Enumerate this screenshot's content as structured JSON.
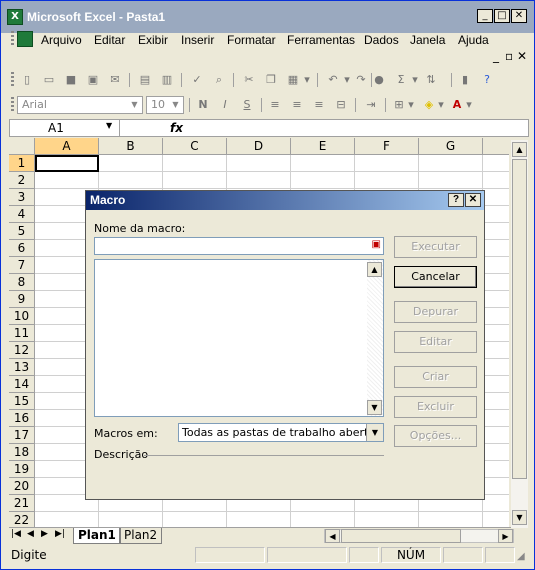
{
  "window": {
    "title": "Microsoft Excel - Pasta1"
  },
  "menu": [
    "Arquivo",
    "Editar",
    "Exibir",
    "Inserir",
    "Formatar",
    "Ferramentas",
    "Dados",
    "Janela",
    "Ajuda"
  ],
  "format_toolbar": {
    "font": "Arial",
    "size": "10"
  },
  "formula_bar": {
    "cell_ref": "A1",
    "fx_label": "fx"
  },
  "columns": [
    "A",
    "B",
    "C",
    "D",
    "E",
    "F",
    "G"
  ],
  "rows": [
    "1",
    "2",
    "3",
    "4",
    "5",
    "6",
    "7",
    "8",
    "9",
    "10",
    "11",
    "12",
    "13",
    "14",
    "15",
    "16",
    "17",
    "18",
    "19",
    "20",
    "21",
    "22"
  ],
  "sheets": [
    "Plan1",
    "Plan2"
  ],
  "status": {
    "left": "Digite",
    "num": "NÚM"
  },
  "dialog": {
    "title": "Macro",
    "name_label": "Nome da macro:",
    "macros_in_label": "Macros em:",
    "macros_in_value": "Todas as pastas de trabalho abertas",
    "description_label": "Descrição",
    "buttons": {
      "run": "Executar",
      "cancel": "Cancelar",
      "step": "Depurar",
      "edit": "Editar",
      "create": "Criar",
      "delete": "Excluir",
      "options": "Opções..."
    }
  }
}
